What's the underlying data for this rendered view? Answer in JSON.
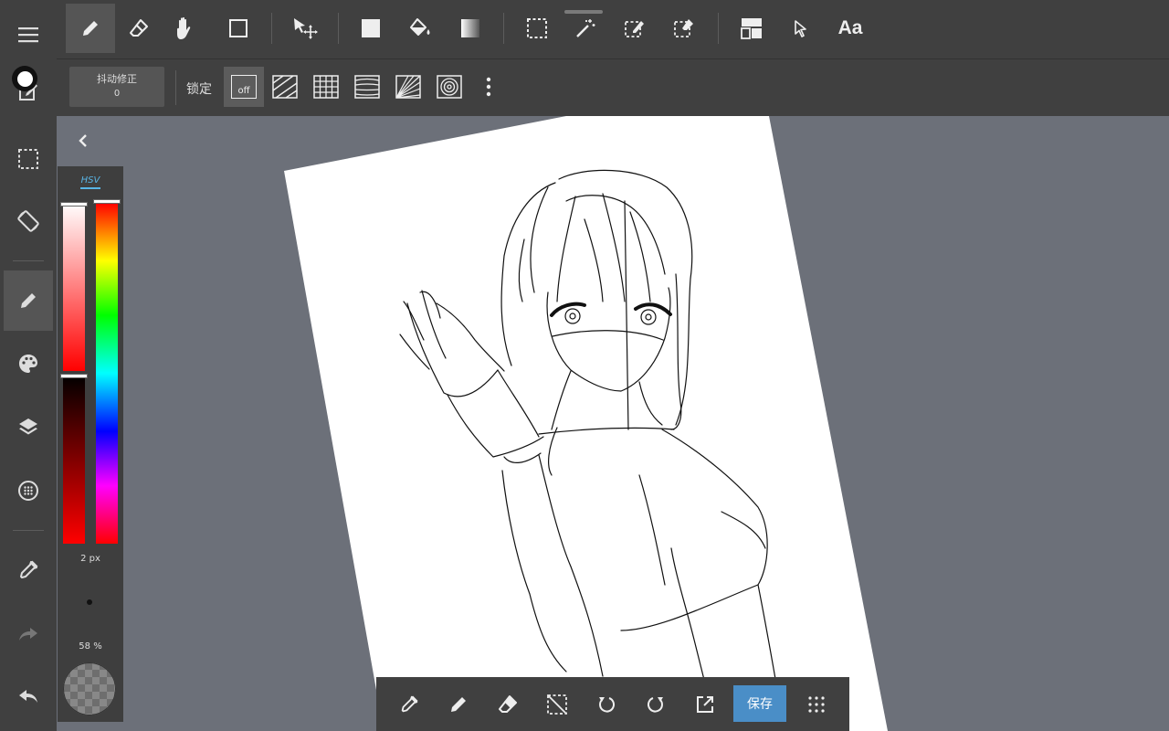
{
  "sub_toolbar": {
    "stabilizer_label": "抖动修正",
    "stabilizer_value": "0",
    "lock_label": "锁定",
    "ruler_off_label": "off"
  },
  "top_toolbar": {
    "text_tool_label": "Aa"
  },
  "color_panel": {
    "mode_tab": "HSV",
    "brush_size": "2 px",
    "opacity": "58 %",
    "current_color": "#ffffff"
  },
  "bottom_toolbar": {
    "save_label": "保存"
  },
  "colors": {
    "canvas_background": "#6c7079",
    "toolbar_background": "#404040",
    "accent": "#4a8ec7",
    "tab_active": "#59b5e6",
    "paper": "#ffffff"
  }
}
